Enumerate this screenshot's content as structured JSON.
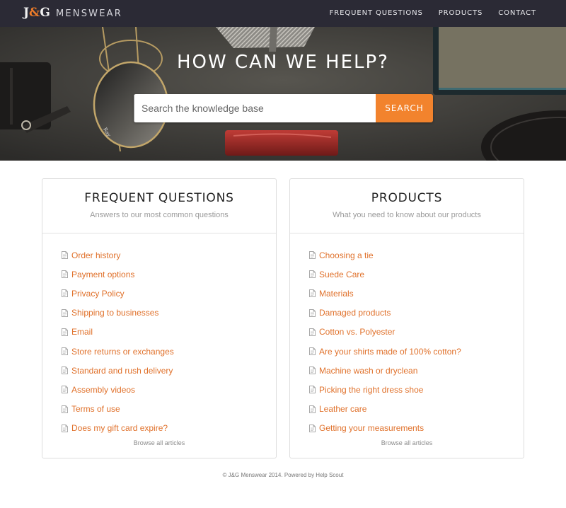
{
  "brand": {
    "logo_left": "J",
    "logo_amp": "&",
    "logo_right": "G",
    "name": "MENSWEAR"
  },
  "nav": [
    "FREQUENT QUESTIONS",
    "PRODUCTS",
    "CONTACT"
  ],
  "hero": {
    "title": "HOW CAN WE HELP?",
    "search_placeholder": "Search the knowledge base",
    "search_value": "",
    "search_button": "SEARCH"
  },
  "cards": [
    {
      "title": "FREQUENT QUESTIONS",
      "subtitle": "Answers to our most common questions",
      "articles": [
        "Order history",
        "Payment options",
        "Privacy Policy",
        "Shipping to businesses",
        "Email",
        "Store returns or exchanges",
        "Standard and rush delivery",
        "Assembly videos",
        "Terms of use",
        "Does my gift card expire?"
      ],
      "browse": "Browse all articles"
    },
    {
      "title": "PRODUCTS",
      "subtitle": "What you need to know about our products",
      "articles": [
        "Choosing a tie",
        "Suede Care",
        "Materials",
        "Damaged products",
        "Cotton vs. Polyester",
        "Are your shirts made of 100% cotton?",
        "Machine wash or dryclean",
        "Picking the right dress shoe",
        "Leather care",
        "Getting your measurements"
      ],
      "browse": "Browse all articles"
    }
  ],
  "footer": {
    "prefix": "© J&G Menswear 2014. Powered by ",
    "link": "Help Scout"
  },
  "colors": {
    "navbar": "#2b2a35",
    "accent": "#f2832d",
    "link": "#e0712b"
  },
  "icons": {
    "article": "document-icon"
  }
}
